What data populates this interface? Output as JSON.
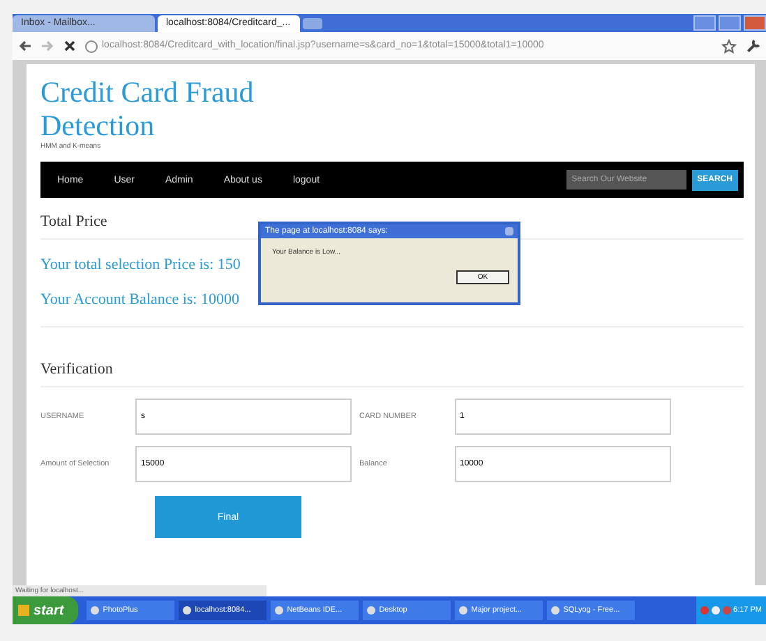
{
  "browser": {
    "tabs": [
      {
        "label": "Inbox - Mailbox...",
        "selected": false
      },
      {
        "label": "localhost:8084/Creditcard_...",
        "selected": true
      }
    ],
    "address": "localhost:8084/Creditcard_with_location/final.jsp?username=s&card_no=1&total=15000&total1=10000",
    "status": "Waiting for localhost..."
  },
  "site": {
    "title": "Credit Card Fraud Detection",
    "subtitle": "HMM and K-means",
    "nav": [
      {
        "label": "Home"
      },
      {
        "label": "User"
      },
      {
        "label": "Admin"
      },
      {
        "label": "About us"
      },
      {
        "label": "logout"
      }
    ],
    "search": {
      "placeholder": "Search Our Website",
      "button": "SEARCH"
    }
  },
  "total": {
    "heading": "Total Price",
    "price_line": "Your total selection Price is: 150",
    "balance_line": "Your Account Balance is: 10000"
  },
  "verification": {
    "heading": "Verification",
    "fields": [
      {
        "label": "USERNAME",
        "value": "s"
      },
      {
        "label": "CARD NUMBER",
        "value": "1"
      },
      {
        "label": "Amount of Selection",
        "value": "15000"
      },
      {
        "label": "Balance",
        "value": "10000"
      }
    ],
    "button": "Final"
  },
  "dialog": {
    "title": "The page at localhost:8084 says:",
    "message": "Your Balance is Low...",
    "button": "OK"
  },
  "taskbar": {
    "start": "start",
    "items": [
      {
        "label": "PhotoPlus",
        "selected": false
      },
      {
        "label": "localhost:8084...",
        "selected": true
      },
      {
        "label": "NetBeans IDE...",
        "selected": false
      },
      {
        "label": "Desktop",
        "selected": false
      },
      {
        "label": "Major project...",
        "selected": false
      },
      {
        "label": "SQLyog - Free...",
        "selected": false
      }
    ],
    "clock": "6:17 PM"
  }
}
